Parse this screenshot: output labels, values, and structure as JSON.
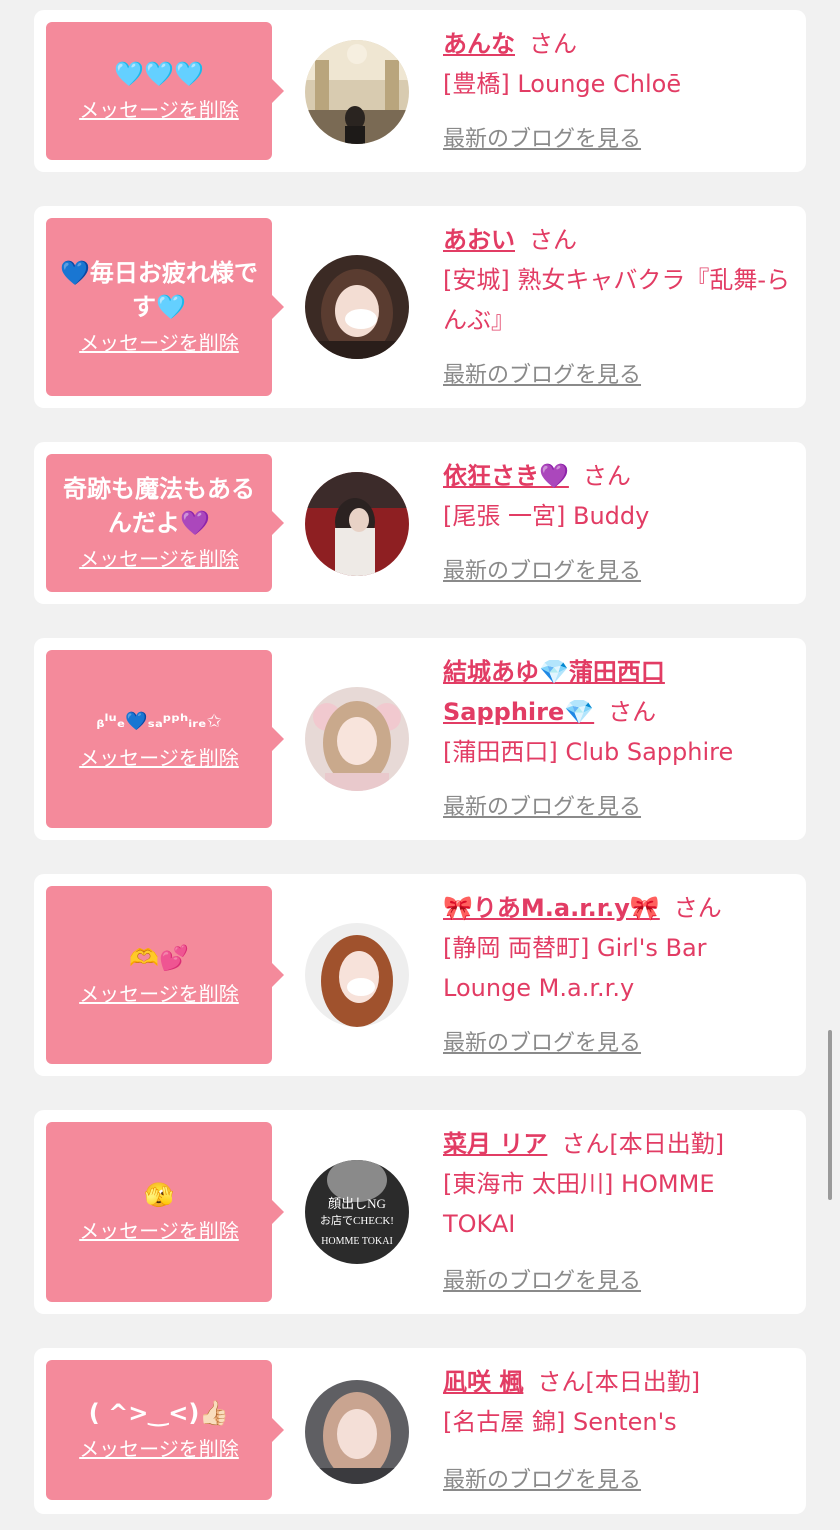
{
  "theme": {
    "accent": "#e23c64",
    "bubble": "#f48a9b",
    "background": "#f1f1f1",
    "link_gray": "#8a8a8a"
  },
  "delete_label": "メッセージを削除",
  "blog_label": "最新のブログを見る",
  "items": [
    {
      "message": "🩵🩵🩵",
      "name": "あんな",
      "honorific": "さん",
      "shop": "[豊橋] Lounge Chloē",
      "avatar": "photo-avatar-icon"
    },
    {
      "message": "💙毎日お疲れ様です🩵",
      "name": "あおい",
      "honorific": "さん",
      "shop": "[安城] 熟女キャバクラ『乱舞-らんぶ』",
      "avatar": "photo-avatar-icon"
    },
    {
      "message": "奇跡も魔法もあるんだよ💜",
      "name": "依狂さき💜",
      "honorific": "さん",
      "shop": "[尾張 一宮] Buddy",
      "avatar": "photo-avatar-icon"
    },
    {
      "message": "ᵦˡᵘₑ💙ₛₐᵖᵖʰᵢᵣₑ✩",
      "name": "結城あゆ💎蒲田西口 Sapphire💎",
      "honorific": "さん",
      "shop": "[蒲田西口] Club Sapphire",
      "avatar": "photo-avatar-icon"
    },
    {
      "message": "🫶💕",
      "name": "🎀りあM.a.r.r.y🎀",
      "honorific": "さん",
      "shop": "[静岡 両替町] Girl's Bar Lounge M.a.r.r.y",
      "avatar": "photo-avatar-icon"
    },
    {
      "message": "🫣",
      "name": "菜月 リア",
      "honorific": "さん[本日出勤]",
      "shop": "[東海市 太田川] HOMME TOKAI",
      "avatar": "photo-avatar-icon",
      "avatar_text": [
        "顔出しNG",
        "お店でCHECK!",
        "HOMME TOKAI"
      ]
    },
    {
      "message": "( ^>‿<)👍🏻",
      "name": "凪咲 楓",
      "honorific": "さん[本日出勤]",
      "shop": "[名古屋 錦] Senten's",
      "avatar": "photo-avatar-icon"
    }
  ]
}
